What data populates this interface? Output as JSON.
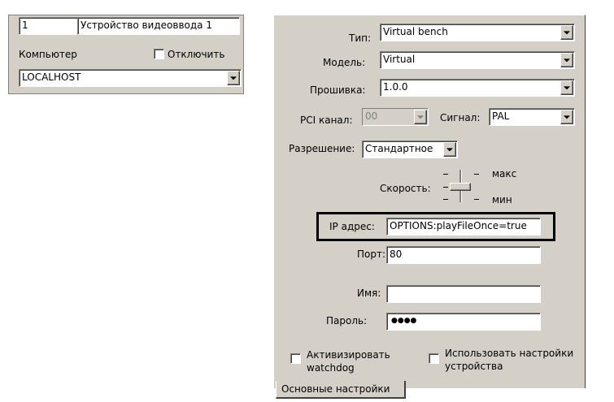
{
  "left_panel": {
    "id_value": "1",
    "name_value": "Устройство видеоввода 1",
    "computer_label": "Компьютер",
    "disable_label": "Отключить",
    "computer_value": "LOCALHOST"
  },
  "right_panel": {
    "type_label": "Тип:",
    "type_value": "Virtual bench",
    "model_label": "Модель:",
    "model_value": "Virtual",
    "firmware_label": "Прошивка:",
    "firmware_value": "1.0.0",
    "pci_label": "PCI канал:",
    "pci_value": "00",
    "signal_label": "Сигнал:",
    "signal_value": "PAL",
    "resolution_label": "Разрешение:",
    "resolution_value": "Стандартное",
    "speed_label": "Скорость:",
    "speed_max": "макс",
    "speed_min": "мин",
    "ip_label": "IP адрес:",
    "ip_value": "OPTIONS:playFileOnce=true",
    "port_label": "Порт:",
    "port_value": "80",
    "name_label": "Имя:",
    "name_value": "",
    "password_label": "Пароль:",
    "password_value": "●●●●",
    "watchdog_label_1": "Активизировать",
    "watchdog_label_2": "watchdog",
    "device_settings_label_1": "Использовать настройки",
    "device_settings_label_2": "устройства",
    "tab_main": "Основные настройки"
  },
  "colors": {
    "panel_bg": "#d4d0c8",
    "highlight_border": "#000000"
  }
}
